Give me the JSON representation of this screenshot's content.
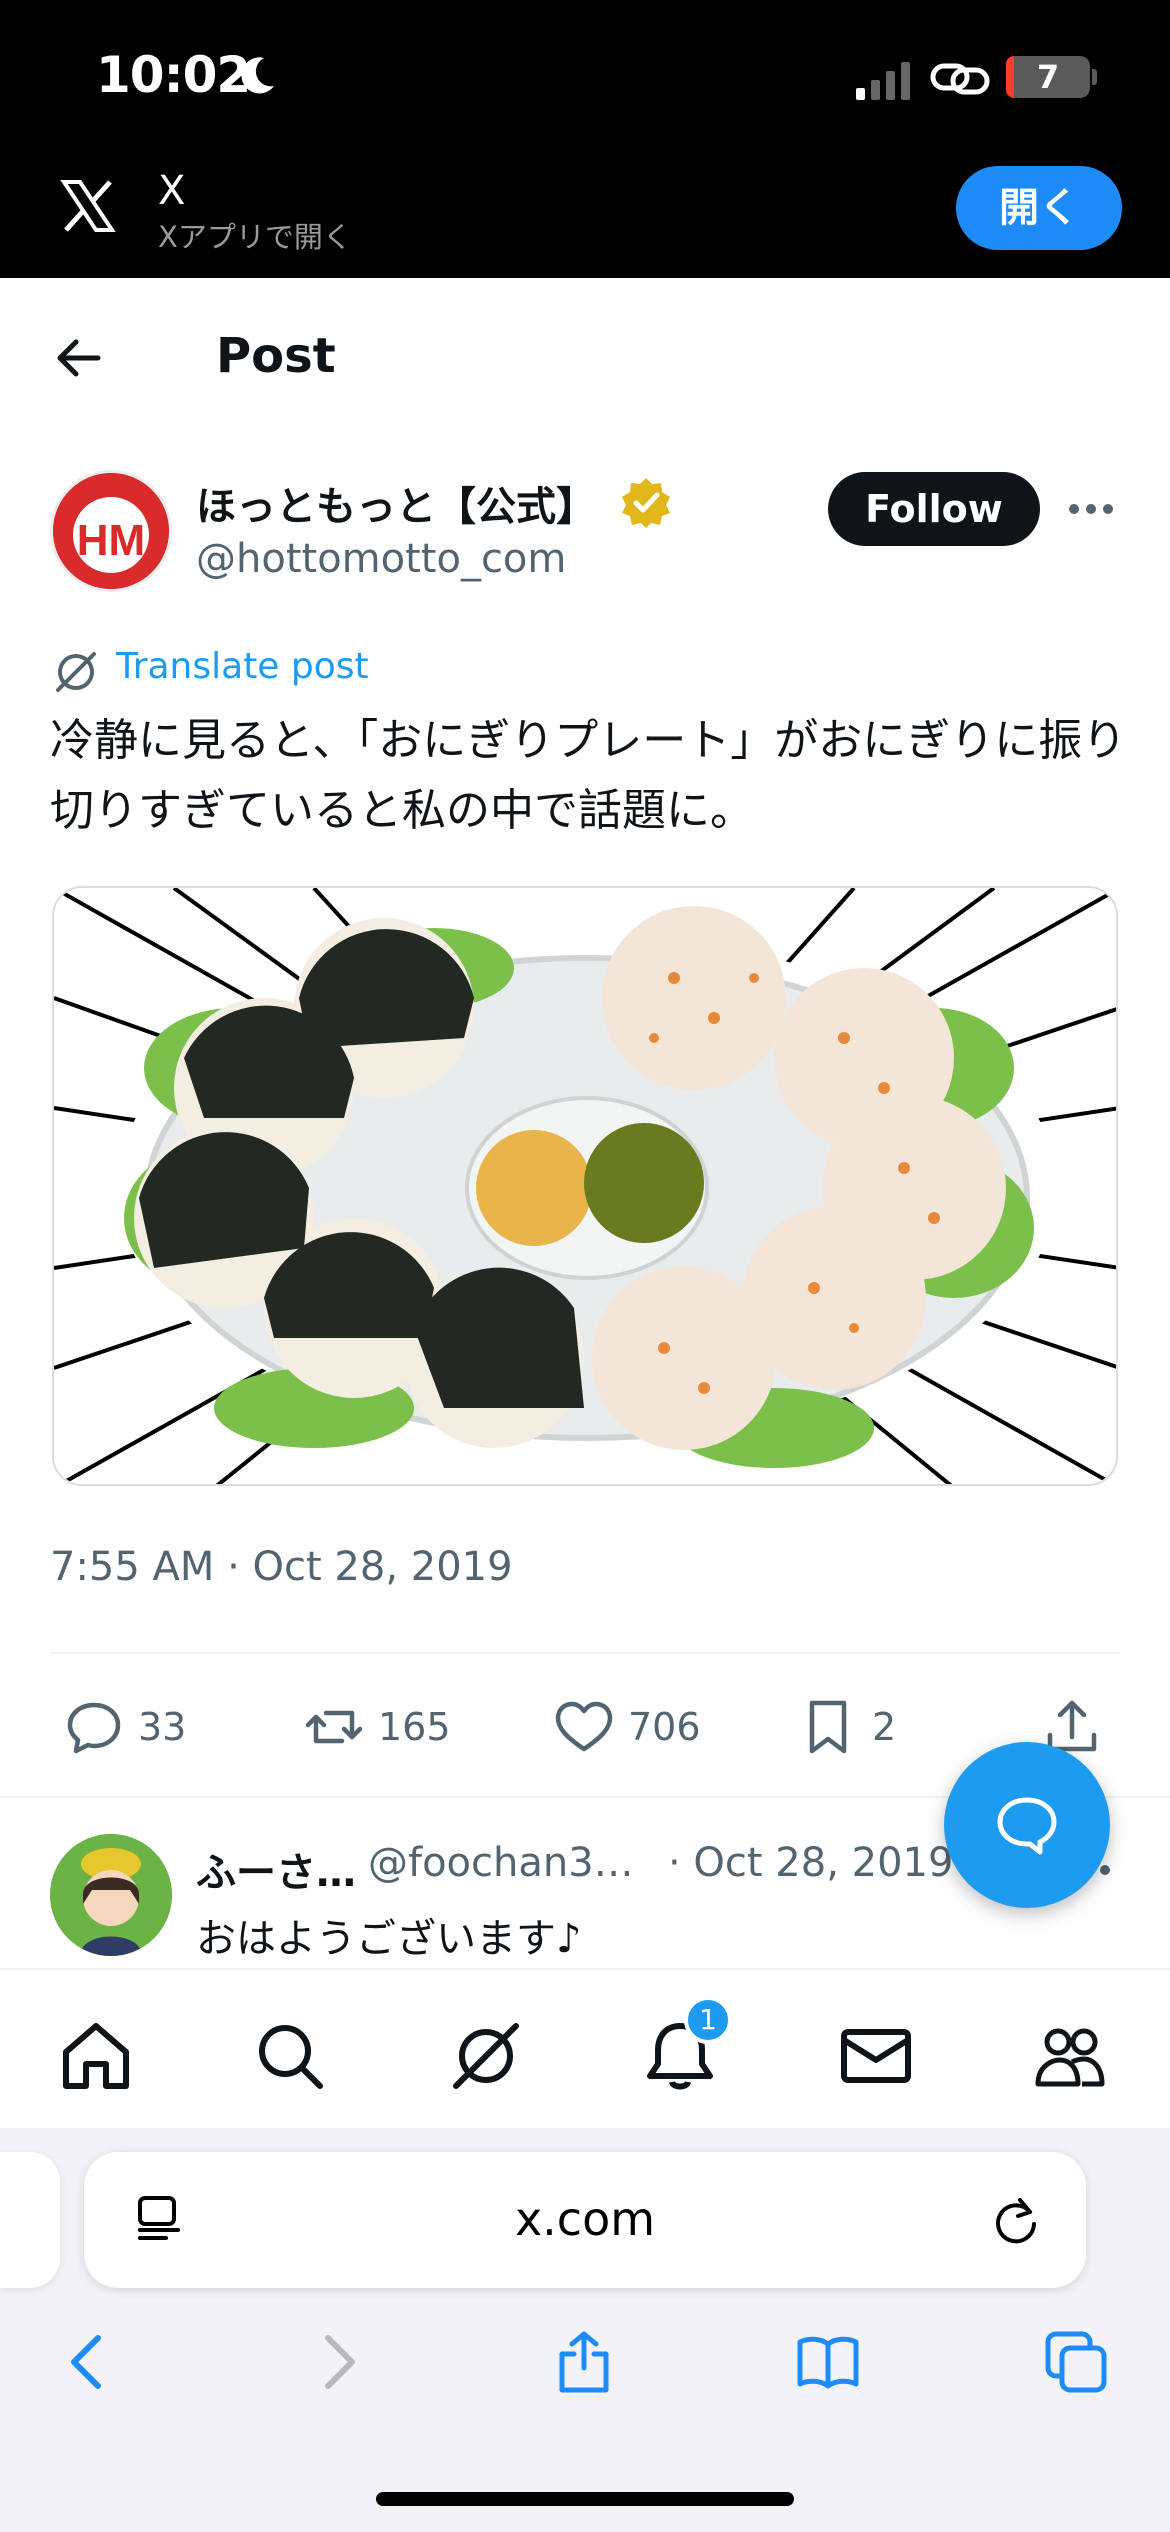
{
  "status_bar": {
    "time": "10:02",
    "battery": "7"
  },
  "app_banner": {
    "app_name": "X",
    "subtitle": "Xアプリで開く",
    "open_label": "開く"
  },
  "header": {
    "title": "Post"
  },
  "post": {
    "display_name": "ほっともっと【公式】",
    "handle": "@hottomotto_com",
    "follow_label": "Follow",
    "translate_label": "Translate post",
    "text": "冷静に見ると、「おにぎりプレート」がおにぎりに振り切りすぎていると私の中で話題に。",
    "timestamp": "7:55 AM · Oct 28, 2019",
    "actions": {
      "replies": "33",
      "reposts": "165",
      "likes": "706",
      "bookmarks": "2"
    }
  },
  "reply": {
    "name": "ふーさ…",
    "handle": "@foochan3…",
    "date": "· Oct 28, 2019",
    "text": "おはようございます♪"
  },
  "tabbar": {
    "notification_count": "1"
  },
  "safari": {
    "url": "x.com"
  },
  "colors": {
    "accent": "#1d9bf0",
    "banner_button": "#1d8cf8",
    "brand_red": "#d92b2b"
  },
  "icons": [
    "moon-icon",
    "signal-icon",
    "link-icon",
    "x-logo-icon",
    "back-arrow-icon",
    "verified-badge-icon",
    "more-icon",
    "translate-icon",
    "reply-icon",
    "repost-icon",
    "like-icon",
    "bookmark-icon",
    "share-icon",
    "compose-icon",
    "home-icon",
    "search-icon",
    "grok-icon",
    "bell-icon",
    "mail-icon",
    "communities-icon",
    "page-menu-icon",
    "reload-icon",
    "chevron-left-icon",
    "chevron-right-icon",
    "safari-share-icon",
    "book-icon",
    "tabs-icon"
  ]
}
